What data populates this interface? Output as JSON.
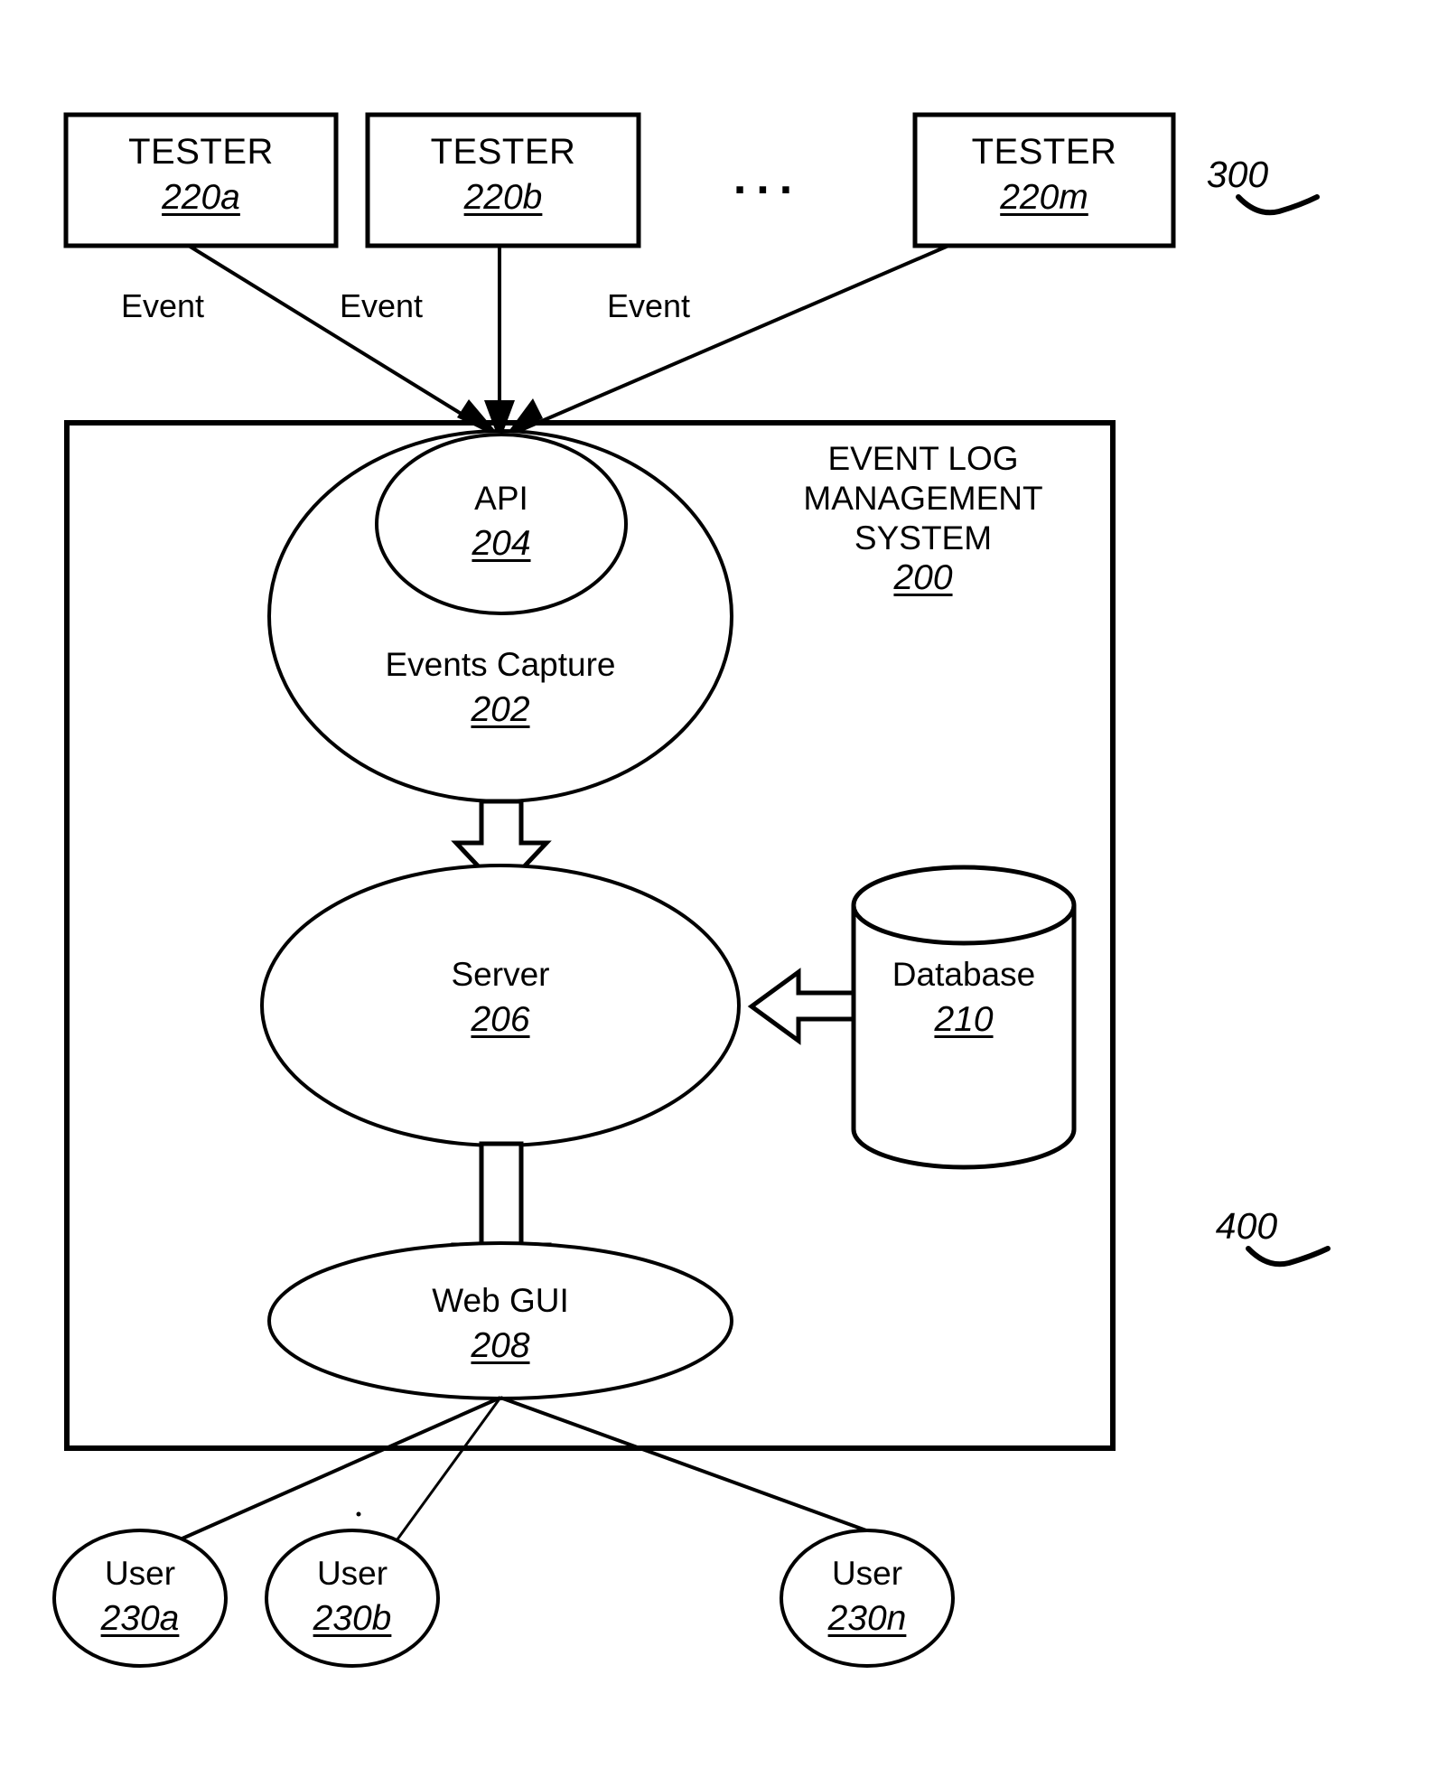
{
  "figure": {
    "type": "patent-block-diagram",
    "title_ref_top": "300",
    "title_ref_bottom": "400",
    "ellipsis": "..."
  },
  "testers": [
    {
      "label": "TESTER",
      "ref": "220a",
      "edge_label": "Event"
    },
    {
      "label": "TESTER",
      "ref": "220b",
      "edge_label": "Event"
    },
    {
      "label": "TESTER",
      "ref": "220m",
      "edge_label": "Event"
    }
  ],
  "system": {
    "title_line1": "EVENT LOG",
    "title_line2": "MANAGEMENT",
    "title_line3": "SYSTEM",
    "ref": "200"
  },
  "nodes": {
    "api": {
      "label": "API",
      "ref": "204"
    },
    "events_capture": {
      "label": "Events Capture",
      "ref": "202"
    },
    "server": {
      "label": "Server",
      "ref": "206"
    },
    "database": {
      "label": "Database",
      "ref": "210"
    },
    "web_gui": {
      "label": "Web GUI",
      "ref": "208"
    }
  },
  "users": [
    {
      "label": "User",
      "ref": "230a"
    },
    {
      "label": "User",
      "ref": "230b"
    },
    {
      "label": "User",
      "ref": "230n"
    }
  ],
  "colors": {
    "stroke": "#000000",
    "background": "#ffffff"
  }
}
